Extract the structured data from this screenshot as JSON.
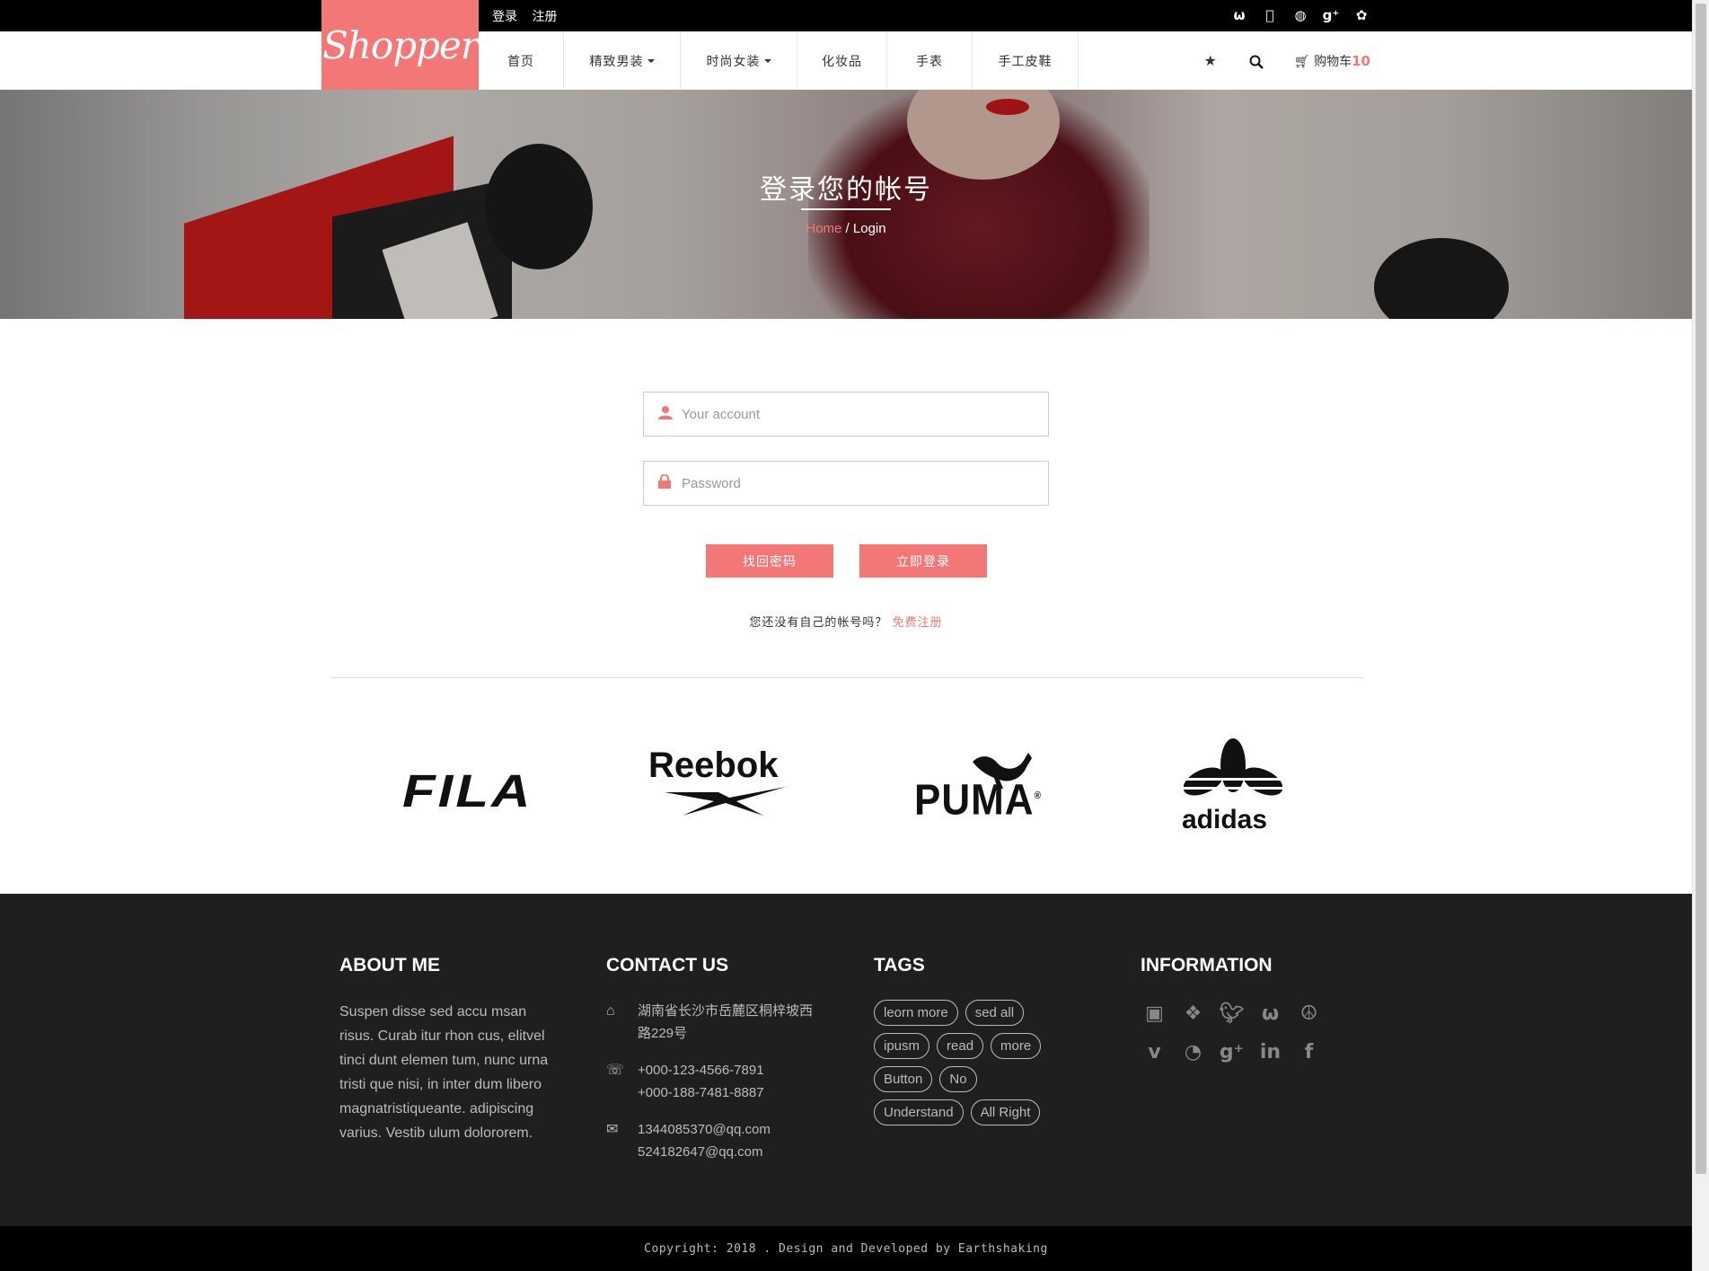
{
  "topbar": {
    "login_label": "登录",
    "register_label": "注册",
    "social_icons": [
      "weibo-icon",
      "apple-icon",
      "dribbble-icon",
      "google-plus-icon",
      "apps-icon"
    ]
  },
  "header": {
    "logo_text": "Shopper",
    "nav": [
      {
        "label": "首页",
        "dropdown": false
      },
      {
        "label": "精致男装",
        "dropdown": true
      },
      {
        "label": "时尚女装",
        "dropdown": true
      },
      {
        "label": "化妆品",
        "dropdown": false
      },
      {
        "label": "手表",
        "dropdown": false
      },
      {
        "label": "手工皮鞋",
        "dropdown": false
      }
    ],
    "cart_label": "购物车",
    "cart_count": "10"
  },
  "banner": {
    "title": "登录您的帐号",
    "breadcrumb_home": "Home",
    "breadcrumb_sep": " / ",
    "breadcrumb_current": "Login"
  },
  "login": {
    "account_placeholder": "Your account",
    "password_placeholder": "Password",
    "forgot_button": "找回密码",
    "login_button": "立即登录",
    "no_account_text": "您还没有自己的帐号吗？",
    "signup_link": "免费注册"
  },
  "brands": {
    "fila": "FILA",
    "reebok": "Reebok",
    "puma": "PUMA",
    "puma_mark": "®",
    "adidas": "adidas"
  },
  "footer": {
    "about": {
      "heading": "ABOUT ME",
      "text": "Suspen disse sed accu msan risus. Curab itur rhon cus, elitvel tinci dunt elemen tum, nunc urna tristi que nisi, in inter dum libero magnatristiqueante. adipiscing varius. Vestib ulum dolororem."
    },
    "contact": {
      "heading": "CONTACT US",
      "address": "湖南省长沙市岳麓区桐梓坡西路229号",
      "phone1": "+000-123-4566-7891",
      "phone2": "+000-188-7481-8887",
      "email1": "1344085370@qq.com",
      "email2": "524182647@qq.com"
    },
    "tags": {
      "heading": "TAGS",
      "items": [
        "leorn more",
        "sed all",
        "ipusm",
        "read",
        "more",
        "Button",
        "No",
        "Understand",
        "All Right"
      ]
    },
    "information": {
      "heading": "INFORMATION",
      "icons": [
        "youtube-icon",
        "dropbox-icon",
        "twitter-icon",
        "weibo-icon",
        "peace-icon",
        "vimeo-icon",
        "rss-icon",
        "google-plus-icon",
        "linkedin-icon",
        "facebook-icon"
      ]
    }
  },
  "copyright": "Copyright: 2018 . Design and Developed by Earthshaking"
}
